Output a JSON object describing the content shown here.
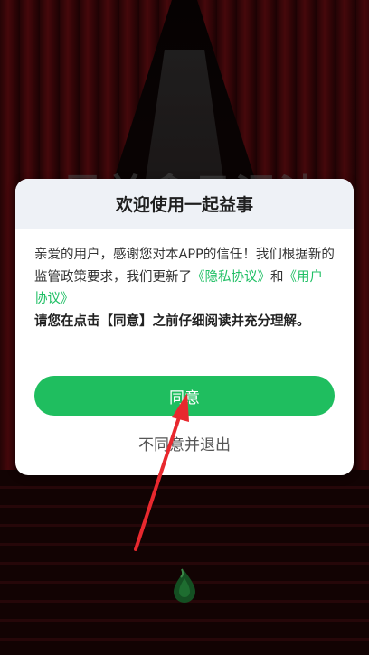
{
  "background": {
    "title_text": "最美拿县浸油"
  },
  "dialog": {
    "title": "欢迎使用一起益事",
    "body_intro": "亲爱的用户，感谢您对本APP的信任！我们根据新的监管政策要求，我们更新了",
    "privacy_link": "《隐私协议》",
    "and_text": "和",
    "user_agreement_link": "《用户协议》",
    "body_strong": "请您在点击【同意】之前仔细阅读并充分理解。",
    "agree_label": "同意",
    "decline_label": "不同意并退出"
  },
  "colors": {
    "accent_green": "#1fbe5f",
    "annotation_red": "#e8282e"
  },
  "icons": {
    "stage_logo": "green-droplet-logo-icon",
    "annotation": "red-arrow-icon"
  }
}
